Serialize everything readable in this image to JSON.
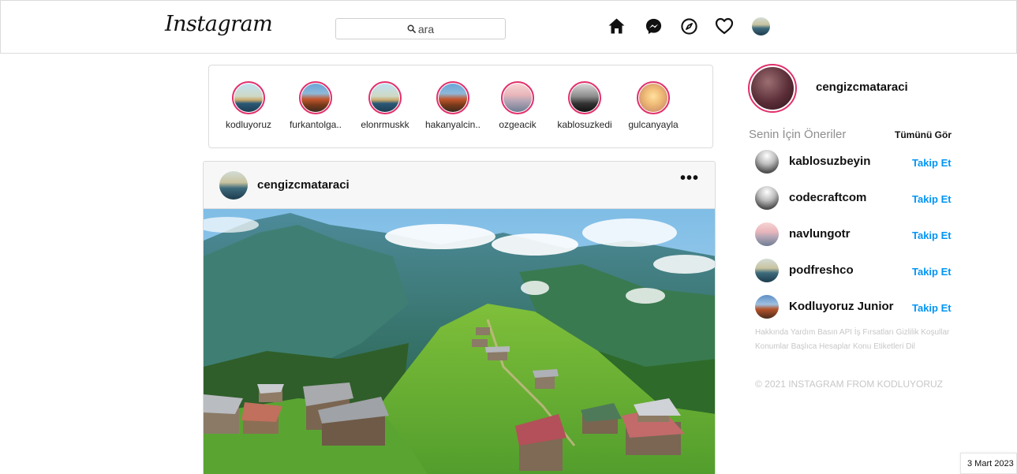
{
  "header": {
    "logo": "Instagram",
    "search_placeholder": "ara",
    "icons": [
      "home-icon",
      "messenger-icon",
      "explore-icon",
      "heart-icon",
      "profile-avatar"
    ]
  },
  "stories": [
    {
      "name": "kodluyoruz",
      "avatar": "av-sky"
    },
    {
      "name": "furkantolga..",
      "avatar": "av-forest"
    },
    {
      "name": "elonrmuskk",
      "avatar": "av-sky"
    },
    {
      "name": "hakanyalcin..",
      "avatar": "av-forest"
    },
    {
      "name": "ozgeacik",
      "avatar": "av-pink"
    },
    {
      "name": "kablosuzkedi",
      "avatar": "av-mono"
    },
    {
      "name": "gulcanyayla",
      "avatar": "av-sunset"
    }
  ],
  "post": {
    "username": "cengizcmataraci",
    "more": "•••"
  },
  "sidebar": {
    "username": "cengizcmataraci",
    "suggestions_title": "Senin İçin Öneriler",
    "see_all": "Tümünü Gör",
    "suggestions": [
      {
        "username": "kablosuzbeyin",
        "follow": "Takip Et",
        "avatar": "av-tower"
      },
      {
        "username": "codecraftcom",
        "follow": "Takip Et",
        "avatar": "av-tower"
      },
      {
        "username": "navlungotr",
        "follow": "Takip Et",
        "avatar": "av-pink"
      },
      {
        "username": "podfreshco",
        "follow": "Takip Et",
        "avatar": "av-lake"
      },
      {
        "username": "Kodluyoruz Junior",
        "follow": "Takip Et",
        "avatar": "av-blue-forest"
      }
    ],
    "footer_links": "Hakkında Yardım Basın API İş Fırsatları Gizlilik Koşullar Konumlar Başlıca Hesaplar Konu Etiketleri Dil",
    "copyright": "© 2021 INSTAGRAM FROM KODLUYORUZ"
  },
  "taskbar": {
    "date": "3 Mart 2023"
  },
  "colors": {
    "accent": "#0095f6",
    "story_ring": "#e1306c",
    "border": "#dbdbdb",
    "muted": "#8e8e8e"
  }
}
